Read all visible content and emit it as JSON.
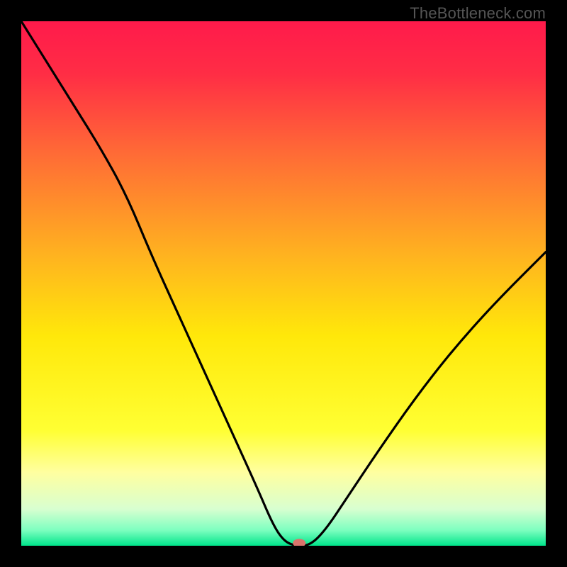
{
  "watermark": "TheBottleneck.com",
  "chart_data": {
    "type": "line",
    "xlabel": "",
    "ylabel": "",
    "xlim": [
      0,
      100
    ],
    "ylim": [
      0,
      100
    ],
    "title": "",
    "background_gradient": [
      {
        "stop": 0.0,
        "color": "#ff1a4b"
      },
      {
        "stop": 0.1,
        "color": "#ff2d45"
      },
      {
        "stop": 0.25,
        "color": "#ff6a36"
      },
      {
        "stop": 0.45,
        "color": "#ffb41f"
      },
      {
        "stop": 0.6,
        "color": "#ffe80a"
      },
      {
        "stop": 0.78,
        "color": "#ffff33"
      },
      {
        "stop": 0.86,
        "color": "#ffffa0"
      },
      {
        "stop": 0.93,
        "color": "#d8ffd0"
      },
      {
        "stop": 0.97,
        "color": "#7effc0"
      },
      {
        "stop": 1.0,
        "color": "#00e58b"
      }
    ],
    "series": [
      {
        "name": "bottleneck-curve",
        "x": [
          0,
          5,
          10,
          15,
          20,
          25,
          30,
          35,
          40,
          45,
          48,
          50,
          52,
          55,
          58,
          62,
          68,
          75,
          82,
          90,
          100
        ],
        "y": [
          100,
          92,
          84,
          76,
          67,
          55,
          44,
          33,
          22,
          11,
          4,
          1,
          0,
          0,
          3,
          9,
          18,
          28,
          37,
          46,
          56
        ]
      }
    ],
    "marker": {
      "x": 53,
      "y": 0.5,
      "color": "#d9736b",
      "rx": 9,
      "ry": 6
    }
  }
}
